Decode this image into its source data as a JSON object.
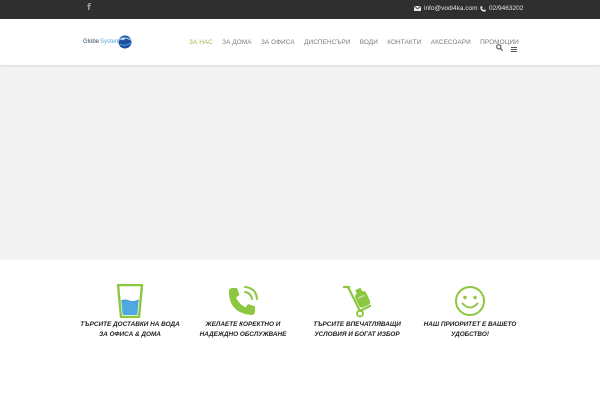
{
  "topbar": {
    "facebook_label": "f",
    "email": "info@vodi4ka.com",
    "phone": "02/9463202"
  },
  "header": {
    "logo_text_1": "Globe",
    "logo_text_2": "System",
    "nav": [
      {
        "label": "ЗА НАС",
        "active": true
      },
      {
        "label": "ЗА ДОМА"
      },
      {
        "label": "ЗА ОФИСА"
      },
      {
        "label": "ДИСПЕНСЪРИ"
      },
      {
        "label": "ВОДИ"
      },
      {
        "label": "КОНТАКТИ"
      },
      {
        "label": "АКСЕСОАРИ"
      },
      {
        "label": "ПРОМОЦИИ"
      }
    ]
  },
  "features": [
    {
      "icon": "water-glass-icon",
      "line1": "ТЪРСИТЕ ДОСТАВКИ НА ВОДА",
      "line2": "ЗА ОФИСА & ДОМА"
    },
    {
      "icon": "phone-icon",
      "line1": "ЖЕЛАЕТЕ КОРЕКТНО И",
      "line2": "НАДЕЖДНО ОБСЛУЖВАНЕ"
    },
    {
      "icon": "hand-truck-icon",
      "line1": "ТЪРСИТЕ ВПЕЧАТЛЯВАЩИ",
      "line2": "УСЛОВИЯ И БОГАТ ИЗБОР"
    },
    {
      "icon": "smiley-icon",
      "line1": "НАШ ПРИОРИТЕТ Е ВАШЕТО",
      "line2": "УДОБСТВО!"
    }
  ],
  "colors": {
    "topbar_bg": "#2f2f2f",
    "nav_active": "#a7b24c",
    "icon_green": "#8dc63f",
    "hero_bg": "#f3f3f3"
  }
}
